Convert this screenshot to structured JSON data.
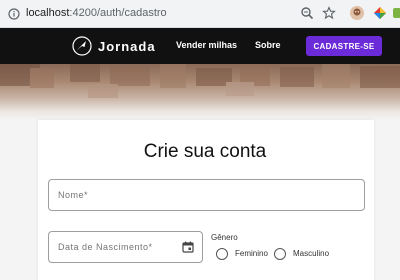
{
  "browser": {
    "url_host": "localhost",
    "url_path": ":4200/auth/cadastro"
  },
  "header": {
    "logo_text": "Jornada",
    "nav": [
      "Vender milhas",
      "Sobre"
    ],
    "cta_label": "CADASTRE-SE",
    "accent_color": "#6c2bd9"
  },
  "form": {
    "title": "Crie sua conta",
    "nome_label": "Nome*",
    "nascimento_label": "Data de Nascimento*",
    "genero_label": "Gênero",
    "genero_options": [
      "Feminino",
      "Masculino"
    ]
  }
}
